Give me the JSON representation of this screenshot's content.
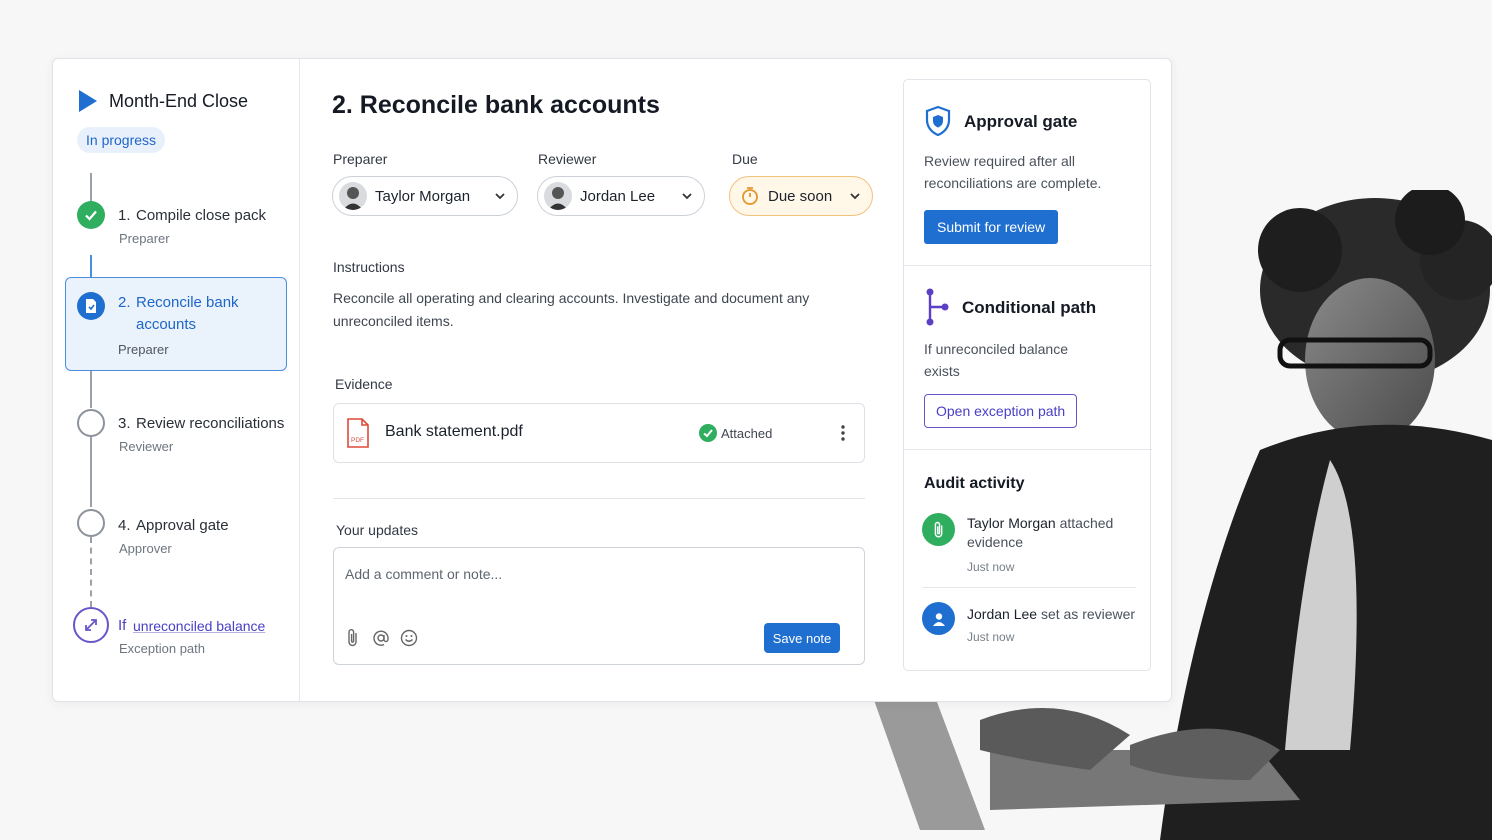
{
  "app": {
    "title": "Month-End Close",
    "status": "In progress"
  },
  "colors": {
    "accent": "#1f6fd1",
    "success": "#2fae5f",
    "warning": "#f0a83c",
    "exception": "#6b55c8"
  },
  "steps": [
    {
      "number": "1.",
      "label": "Compile close pack",
      "role": "Preparer",
      "state": "complete"
    },
    {
      "number": "2.",
      "label": "Reconcile bank accounts",
      "role": "Preparer",
      "state": "active"
    },
    {
      "number": "3.",
      "label": "Review reconciliations",
      "role": "Reviewer",
      "state": "pending"
    },
    {
      "number": "4.",
      "label": "Approval gate",
      "role": "Approver",
      "state": "pending"
    }
  ],
  "exception_step": {
    "prefix": "If",
    "label": "unreconciled balance",
    "sub": "Exception path"
  },
  "task": {
    "title": "2. Reconcile bank accounts",
    "preparer_label": "Preparer",
    "preparer": "Taylor Morgan",
    "reviewer_label": "Reviewer",
    "reviewer": "Jordan Lee",
    "due_label": "Due",
    "due": "Due soon",
    "instructions_label": "Instructions",
    "instructions": "Reconcile all operating and clearing accounts. Investigate and document any unreconciled items.",
    "evidence_label": "Evidence",
    "evidence_file": "Bank statement.pdf",
    "evidence_status": "Attached",
    "updates_label": "Your updates",
    "comment_placeholder": "Add a comment or note...",
    "save_label": "Save note"
  },
  "approval": {
    "title": "Approval gate",
    "text": "Review required after all reconciliations are complete.",
    "button": "Submit for review"
  },
  "conditional": {
    "title": "Conditional path",
    "text": "If unreconciled balance exists",
    "button": "Open exception path"
  },
  "audit": {
    "title": "Audit activity",
    "items": [
      {
        "actor": "Taylor Morgan",
        "action": "attached evidence",
        "time": "Just now",
        "icon": "paperclip-icon"
      },
      {
        "actor": "Jordan Lee",
        "action": "set as reviewer",
        "time": "Just now",
        "icon": "user-icon"
      }
    ]
  }
}
